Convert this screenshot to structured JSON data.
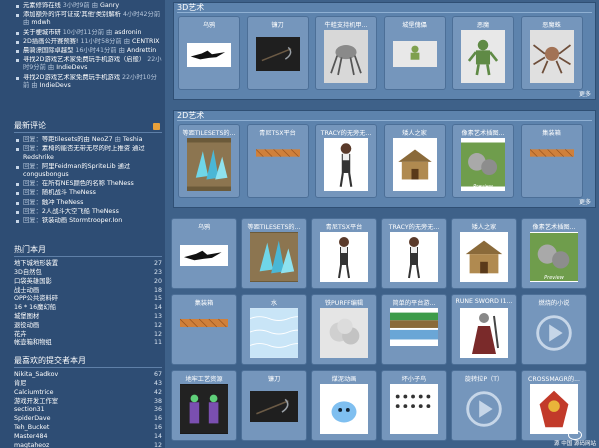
{
  "sidebar": {
    "top_items": [
      {
        "title": "元素修饰在线",
        "time": "3小时9前",
        "author": "Ganry"
      },
      {
        "title": "添加额外的许可证或'其他'类别解析",
        "time": "4小时42分前",
        "author": "mdwh"
      },
      {
        "title": "关于梗城市研",
        "time": "10小时11分前",
        "author": "asdronin"
      },
      {
        "title": "2D插画公开赛预赛!",
        "time": "11小时58分前",
        "author": "CENTRIX"
      },
      {
        "title": "晨骑漂国际卓越型",
        "time": "16小时41分前",
        "author": "Andrettin"
      },
      {
        "title": "寻找2D游戏艺术家免费玩手机游戏（启般）",
        "time": "22小时9分前",
        "author": "IndieDevs"
      },
      {
        "title": "寻找2D游戏艺术家免费玩手机游戏",
        "time": "22小时10分前",
        "author": "IndieDevs"
      }
    ],
    "comments_title": "最新评论",
    "comments": [
      {
        "prefix": "回复：",
        "title": "等距tilesets的由",
        "mid": "NeoZ7",
        "by": "Teshia"
      },
      {
        "prefix": "回复：",
        "title": "素椅的能否无带无尽的时上推资 通过",
        "mid": "",
        "by": "Redshrike"
      },
      {
        "prefix": "回复：",
        "title": "阿里Feidman的SpriteLib 通过",
        "mid": "",
        "by": "congusbongus"
      },
      {
        "prefix": "回复：",
        "title": "在所有NES颜色的名称",
        "mid": "",
        "by": "TheNess"
      },
      {
        "prefix": "回复：",
        "title": "随机战斗",
        "mid": "",
        "by": "TheNess"
      },
      {
        "prefix": "回复：",
        "title": "触冲",
        "mid": "",
        "by": "TheNess"
      },
      {
        "prefix": "回复：",
        "title": "2人战斗大空飞船",
        "mid": "",
        "by": "TheNess"
      },
      {
        "prefix": "回复：",
        "title": "铁装动画",
        "mid": "",
        "by": "Stormtrooper.Ion"
      }
    ],
    "hot_title": "热门本月",
    "hot": [
      {
        "label": "地下城地形装置",
        "count": "27"
      },
      {
        "label": "3D自然包",
        "count": "23"
      },
      {
        "label": "口袋英雄国影",
        "count": "20"
      },
      {
        "label": "战士动画",
        "count": "18"
      },
      {
        "label": "OPP公共资料碎",
        "count": "15"
      },
      {
        "label": "16 * 16魔幻船",
        "count": "14"
      },
      {
        "label": "城堡图材",
        "count": "13"
      },
      {
        "label": "退役动画",
        "count": "12"
      },
      {
        "label": "花卉",
        "count": "12"
      },
      {
        "label": "帐壶箱和物组",
        "count": "11"
      }
    ],
    "contrib_title": "最喜欢的提交者本月",
    "contrib": [
      {
        "label": "Nikita_Sadkov",
        "count": "67"
      },
      {
        "label": "肯尼",
        "count": "43"
      },
      {
        "label": "Calciumtrice",
        "count": "42"
      },
      {
        "label": "游戏开发工作室",
        "count": "38"
      },
      {
        "label": "section31",
        "count": "36"
      },
      {
        "label": "SpiderDave",
        "count": "16"
      },
      {
        "label": "Teh_Bucket",
        "count": "16"
      },
      {
        "label": "Master484",
        "count": "14"
      },
      {
        "label": "magtaheoz",
        "count": "12"
      }
    ]
  },
  "box3d": {
    "title": "3D艺术",
    "more": "更多",
    "cards": [
      "乌鸦",
      "镰刀",
      "牛蛙支持机甲...",
      "城堡傀儡",
      "恶魔",
      "恶魔蛛"
    ]
  },
  "box2d": {
    "title": "2D艺术",
    "more": "更多",
    "cards": [
      "等距TILESETS的...",
      "青尼TSX平台",
      "TRACY的无旁无...",
      "矮人之家",
      "像素艺术插图...",
      "集装箱"
    ]
  },
  "grid": {
    "row1": [
      "乌鸦",
      "等距TILESETS的...",
      "青尼TSX平台",
      "TRACY的无旁无...",
      "矮人之家",
      "像素艺术插图..."
    ],
    "row2": [
      "集装箱",
      "水",
      "铁PURFF编辑",
      "简单的平台游...",
      "RUNE SWORD I1...",
      "燃烧的小说"
    ],
    "row3": [
      "地牢工艺资源",
      "镰刀",
      "煤泥动画",
      "坏小子鸟",
      "旋转拉P（T）",
      "CROSSMAGR的..."
    ]
  },
  "preview_label": "Preview",
  "watermark": "源 中国\n源码网站"
}
